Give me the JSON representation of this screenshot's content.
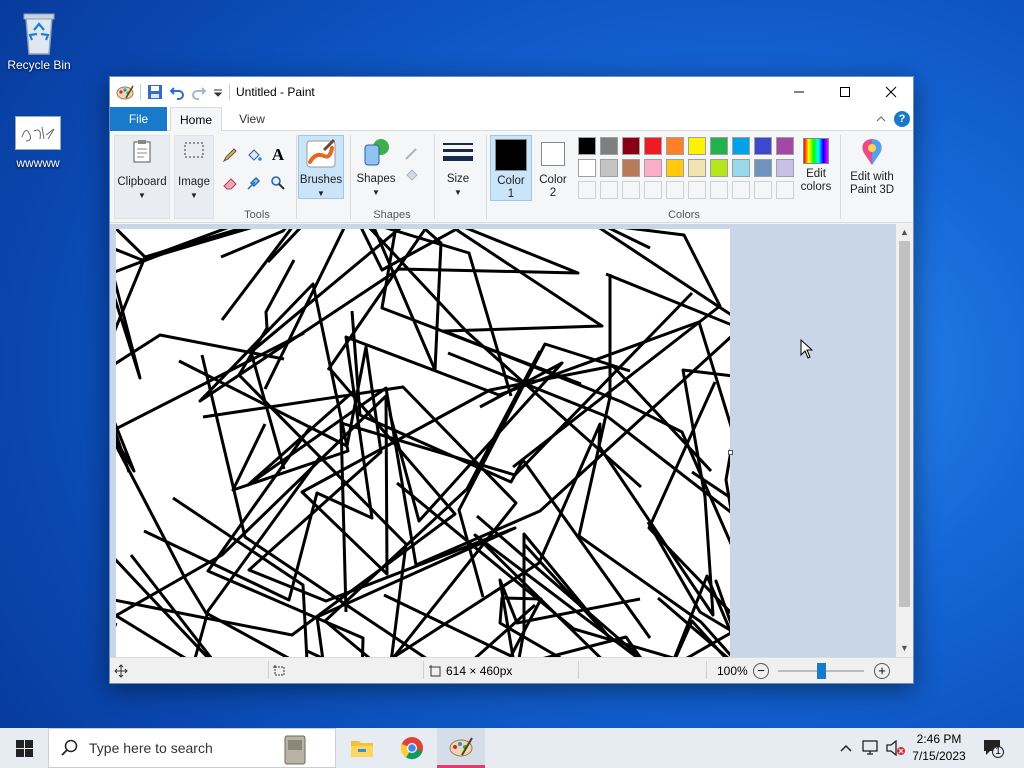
{
  "desktop": {
    "icons": [
      {
        "label": "Recycle Bin",
        "icon": "recycle-bin-icon"
      },
      {
        "label": "wwwww",
        "icon": "image-file-icon"
      }
    ]
  },
  "window": {
    "title": "Untitled - Paint",
    "controls": {
      "minimize": "minimize-icon",
      "maximize": "maximize-icon",
      "close": "close-icon"
    }
  },
  "ribbon": {
    "tabs": [
      "File",
      "Home",
      "View"
    ],
    "active_tab": "Home",
    "clipboard": {
      "label": "Clipboard"
    },
    "image": {
      "label": "Image"
    },
    "tools": {
      "group_label": "Tools",
      "items": [
        "pencil-icon",
        "fill-icon",
        "text-icon",
        "eraser-icon",
        "color-picker-icon",
        "magnifier-icon"
      ]
    },
    "brushes": {
      "label": "Brushes"
    },
    "shapes": {
      "label": "Shapes",
      "group_label": "Shapes"
    },
    "size": {
      "label": "Size"
    },
    "color1": {
      "label_line1": "Color",
      "label_line2": "1",
      "value": "#000000"
    },
    "color2": {
      "label_line1": "Color",
      "label_line2": "2",
      "value": "#ffffff"
    },
    "colors": {
      "group_label": "Colors",
      "row1": [
        "#000000",
        "#7f7f7f",
        "#880015",
        "#ed1c24",
        "#ff7f27",
        "#fff200",
        "#22b14c",
        "#00a2e8",
        "#3f48cc",
        "#a349a4"
      ],
      "row2": [
        "#ffffff",
        "#c3c3c3",
        "#b97a57",
        "#ffaec9",
        "#ffc90e",
        "#efe4b0",
        "#b5e61d",
        "#99d9ea",
        "#7092be",
        "#c8bfe7"
      ]
    },
    "edit_colors": {
      "label_line1": "Edit",
      "label_line2": "colors"
    },
    "paint3d": {
      "label_line1": "Edit with",
      "label_line2": "Paint 3D"
    }
  },
  "status": {
    "dimensions": "614 × 460px",
    "zoom": "100%"
  },
  "taskbar": {
    "search_placeholder": "Type here to search",
    "time": "2:46 PM",
    "date": "7/15/2023",
    "notification_count": "1"
  }
}
